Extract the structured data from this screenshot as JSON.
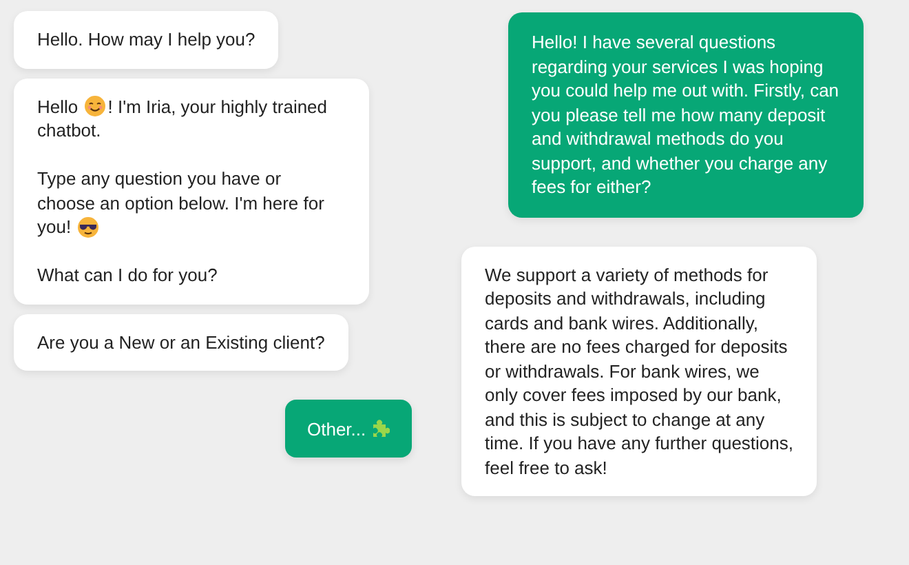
{
  "bot_messages": [
    {
      "paragraphs": [
        [
          [
            {
              "kind": "text",
              "text": "Hello. How may I help you?"
            }
          ]
        ]
      ]
    },
    {
      "paragraphs": [
        [
          [
            {
              "kind": "text",
              "text": "Hello "
            },
            {
              "kind": "emoji-smile"
            },
            {
              "kind": "text",
              "text": "! I'm Iria, your highly trained"
            }
          ],
          [
            {
              "kind": "text",
              "text": "chatbot."
            }
          ]
        ],
        [
          [
            {
              "kind": "text",
              "text": "Type any question you have or"
            }
          ],
          [
            {
              "kind": "text",
              "text": "choose an option below. I'm here for"
            }
          ],
          [
            {
              "kind": "text",
              "text": "you! "
            },
            {
              "kind": "emoji-sunglasses"
            }
          ]
        ],
        [
          [
            {
              "kind": "text",
              "text": "What can I do for you?"
            }
          ]
        ]
      ]
    },
    {
      "paragraphs": [
        [
          [
            {
              "kind": "text",
              "text": "Are you a New or an Existing client?"
            }
          ]
        ]
      ]
    }
  ],
  "option_button": {
    "label": "Other..."
  },
  "conversation": [
    {
      "kind": "user",
      "text": "Hello! I have several questions regarding your services I was hoping you could help me out with. Firstly, can you please tell me how many deposit and withdrawal methods do you support, and whether you charge any fees for either?"
    },
    {
      "kind": "bot",
      "text": "We support a variety of methods for deposits and withdrawals, including cards and bank wires. Additionally, there are no fees charged for deposits or withdrawals. For bank wires, we only cover fees imposed by our bank, and this is subject to change at any time. If you have any further questions, feel free to ask!"
    }
  ]
}
